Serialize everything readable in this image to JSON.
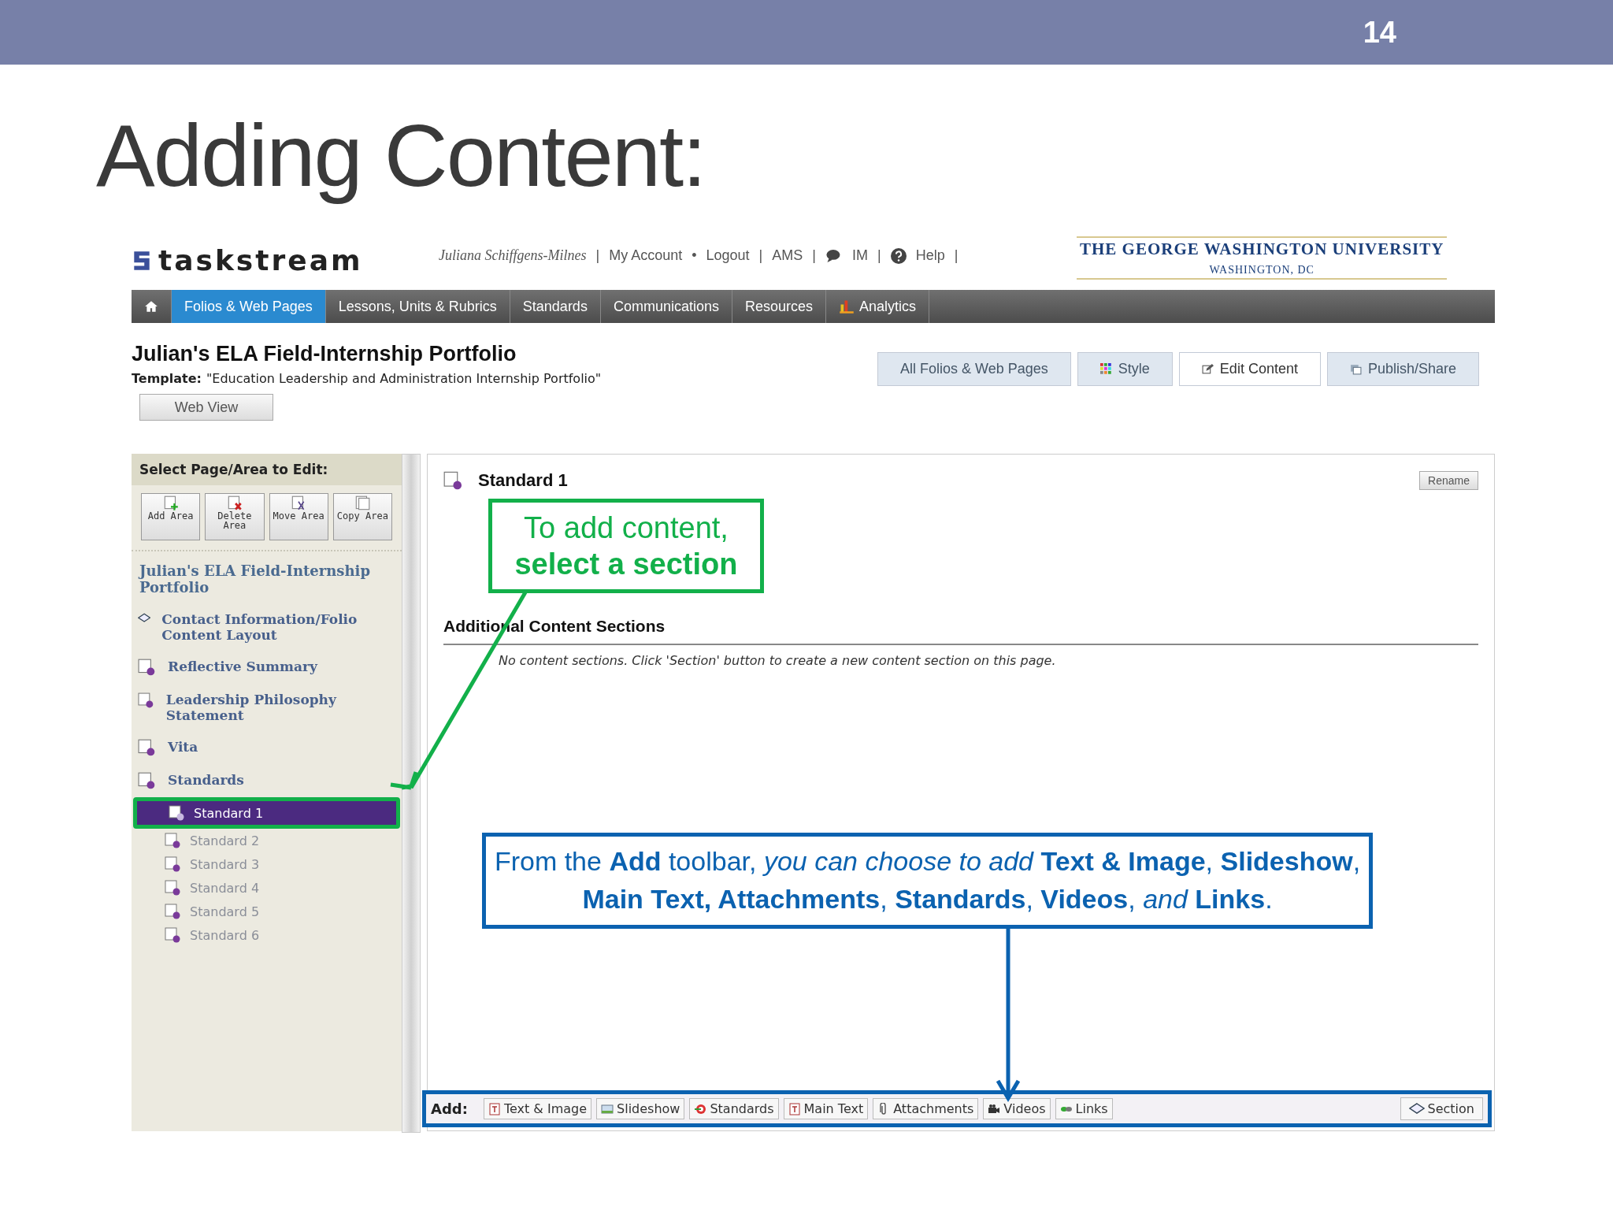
{
  "slide": {
    "number": "14",
    "title": "Adding Content:"
  },
  "header": {
    "logo": "taskstream",
    "user": "Juliana Schiffgens-Milnes",
    "links": [
      {
        "label": "My Account",
        "sep": "|"
      },
      {
        "label": "Logout",
        "sep": "•"
      },
      {
        "label": "AMS",
        "sep": "|"
      },
      {
        "label": "IM",
        "sep": "|"
      },
      {
        "label": "Help",
        "sep": "|"
      }
    ],
    "link_end_sep": "|",
    "university": {
      "name": "THE GEORGE WASHINGTON UNIVERSITY",
      "location": "WASHINGTON, DC"
    }
  },
  "nav": [
    {
      "kind": "home",
      "selected": false
    },
    {
      "kind": "text",
      "label": "Folios & Web Pages",
      "selected": true
    },
    {
      "kind": "text",
      "label": "Lessons, Units & Rubrics",
      "selected": false
    },
    {
      "kind": "text",
      "label": "Standards",
      "selected": false
    },
    {
      "kind": "text",
      "label": "Communications",
      "selected": false
    },
    {
      "kind": "text",
      "label": "Resources",
      "selected": false
    },
    {
      "kind": "chart",
      "label": "Analytics",
      "selected": false
    }
  ],
  "portfolio": {
    "title": "Julian's ELA Field-Internship Portfolio",
    "template_label": "Template:",
    "template": "\"Education Leadership and Administration Internship Portfolio\""
  },
  "tabs": [
    {
      "label": "All Folios & Web Pages",
      "selected": false
    },
    {
      "label": "Style",
      "selected": false
    },
    {
      "label": "Edit Content",
      "selected": true
    },
    {
      "label": "Publish/Share",
      "selected": false
    }
  ],
  "web_view_button": "Web View",
  "sidebar": {
    "heading": "Select Page/Area to Edit:",
    "tools": [
      {
        "label": "Add Area"
      },
      {
        "label": "Delete Area"
      },
      {
        "label": "Move Area"
      },
      {
        "label": "Copy Area"
      }
    ],
    "root": "Julian's ELA Field-Internship Portfolio",
    "items": [
      {
        "label": "Contact Information/Folio Content Layout"
      },
      {
        "label": "Reflective Summary"
      },
      {
        "label": "Leadership Philosophy Statement"
      },
      {
        "label": "Vita"
      },
      {
        "label": "Standards",
        "children": [
          {
            "label": "Standard 1",
            "selected": true,
            "highlighted": true
          },
          {
            "label": "Standard 2",
            "selected": false,
            "highlighted": false
          },
          {
            "label": "Standard 3",
            "selected": false,
            "highlighted": false
          },
          {
            "label": "Standard 4",
            "selected": false,
            "highlighted": false
          },
          {
            "label": "Standard 5",
            "selected": false,
            "highlighted": false
          },
          {
            "label": "Standard 6",
            "selected": false,
            "highlighted": false
          }
        ]
      }
    ]
  },
  "main": {
    "heading": "Standard 1",
    "rename_button": "Rename",
    "section_heading": "Additional Content Sections",
    "empty_message": "No content sections. Click 'Section' button to create a new content section on this page.",
    "add_toolbar": {
      "label": "Add:",
      "highlighted": true,
      "buttons": [
        {
          "label": "Text & Image"
        },
        {
          "label": "Slideshow"
        },
        {
          "label": "Standards"
        },
        {
          "label": "Main Text"
        },
        {
          "label": "Attachments"
        },
        {
          "label": "Videos"
        },
        {
          "label": "Links"
        }
      ],
      "section_button": "Section"
    }
  },
  "annotations": [
    {
      "kind": "green",
      "text": "To add content,\n**select a section**"
    },
    {
      "kind": "blue",
      "text": "From the **Add** toolbar, *you can choose to add* **Text & Image**, **Slideshow**, **Main Text, Attachments**, **Standards**, **Videos**, *and* **Links**."
    }
  ]
}
